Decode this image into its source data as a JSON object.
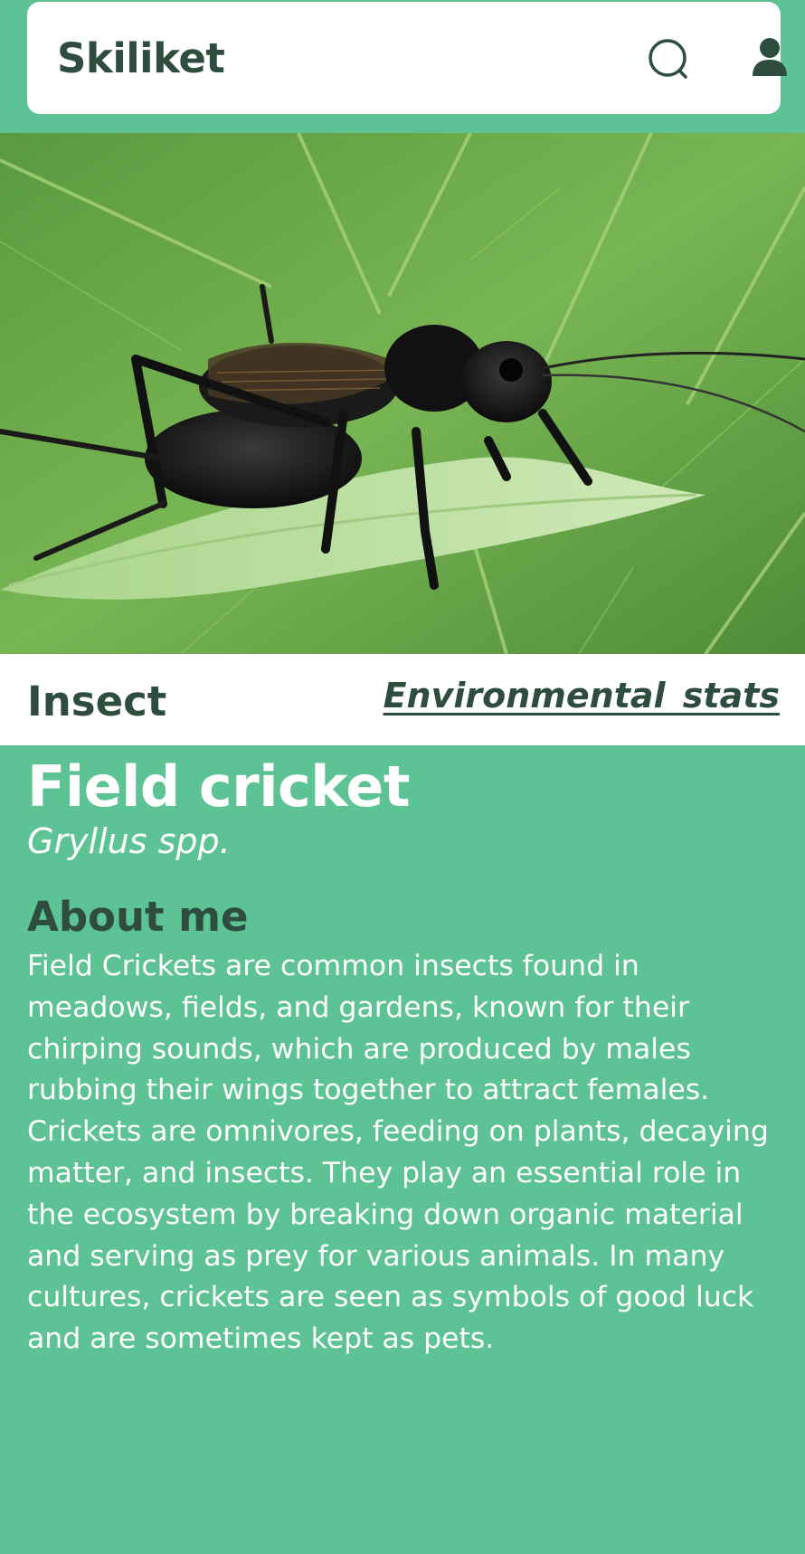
{
  "header": {
    "app_title": "Skiliket"
  },
  "species": {
    "category": "Insect",
    "stats_link": "Environmental  stats",
    "common_name": "Field cricket",
    "scientific_name": "Gryllus spp.",
    "about_heading": "About me",
    "about_text": "Field Crickets are common insects found in meadows, fields, and gardens, known for their chirping sounds, which are produced by males rubbing their wings together to attract females. Crickets are omnivores, feeding on plants, decaying matter, and insects. They play an essential role in the ecosystem by breaking down organic material and serving as prey for various animals. In many cultures, crickets are seen as symbols of good luck and are sometimes kept as pets."
  },
  "colors": {
    "brand_green": "#5dc394",
    "dark_text": "#2e4d3f",
    "card_white": "#ffffff"
  },
  "icons": {
    "search": "search-icon",
    "user": "user-icon"
  }
}
